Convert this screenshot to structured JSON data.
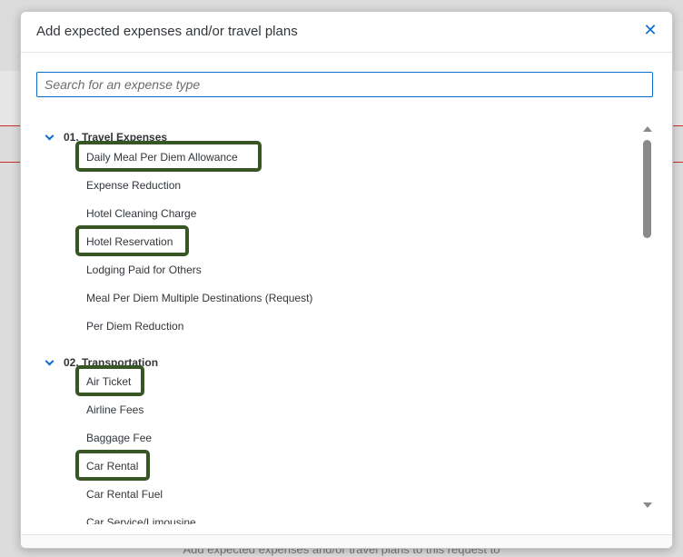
{
  "dialog": {
    "title": "Add expected expenses and/or travel plans",
    "close_icon": "close-icon"
  },
  "search": {
    "placeholder": "Search for an expense type",
    "value": ""
  },
  "groups": [
    {
      "label": "01. Travel Expenses",
      "items": [
        "Daily Meal Per Diem Allowance",
        "Expense Reduction",
        "Hotel Cleaning Charge",
        "Hotel Reservation",
        "Lodging Paid for Others",
        "Meal Per Diem Multiple Destinations (Request)",
        "Per Diem Reduction"
      ]
    },
    {
      "label": "02. Transportation",
      "items": [
        "Air Ticket",
        "Airline Fees",
        "Baggage Fee",
        "Car Rental",
        "Car Rental Fuel",
        "Car Service/Limousine"
      ]
    }
  ],
  "highlighted_items": [
    "Daily Meal Per Diem Allowance",
    "Hotel Reservation",
    "Air Ticket",
    "Car Rental"
  ],
  "background_footer_text": "Add expected expenses and/or travel plans to this request to",
  "colors": {
    "accent": "#0a6ed1",
    "highlight_border": "#375623"
  }
}
